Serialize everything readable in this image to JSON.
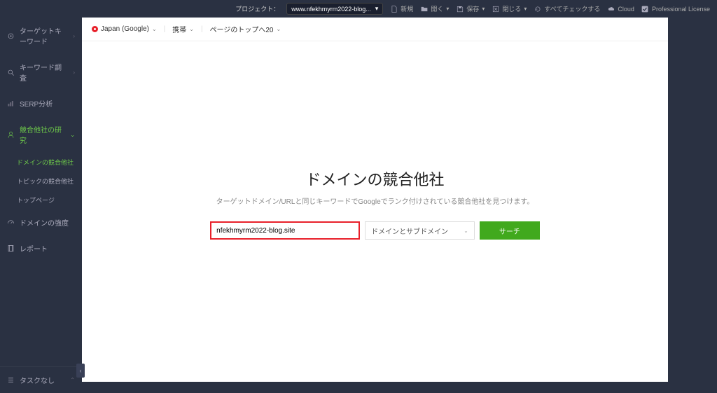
{
  "topbar": {
    "project_label": "プロジェクト：",
    "project_value": "www.nfekhmyrm2022-blog...",
    "new_label": "新規",
    "open_label": "開く",
    "save_label": "保存",
    "close_label": "閉じる",
    "checkall_label": "すべてチェックする",
    "cloud_label": "Cloud",
    "license_label": "Professional License"
  },
  "sidebar": {
    "items": [
      {
        "label": "ターゲットキーワード",
        "icon": "target-icon"
      },
      {
        "label": "キーワード調査",
        "icon": "search-icon"
      },
      {
        "label": "SERP分析",
        "icon": "chart-icon"
      },
      {
        "label": "競合他社の研究",
        "icon": "people-icon"
      },
      {
        "label": "ドメインの強度",
        "icon": "gauge-icon"
      },
      {
        "label": "レポート",
        "icon": "document-icon"
      }
    ],
    "subs": [
      {
        "label": "ドメインの競合他社"
      },
      {
        "label": "トピックの競合他社"
      },
      {
        "label": "トップページ"
      }
    ],
    "tasks_label": "タスクなし"
  },
  "header": {
    "region": "Japan (Google)",
    "device": "携帯",
    "top_label": "ページのトップへ20"
  },
  "main": {
    "title": "ドメインの競合他社",
    "subtitle": "ターゲットドメイン/URLと同じキーワードでGoogleでランク付けされている競合他社を見つけます。",
    "input_value": "nfekhmyrm2022-blog.site",
    "scope_label": "ドメインとサブドメイン",
    "search_label": "サーチ"
  }
}
